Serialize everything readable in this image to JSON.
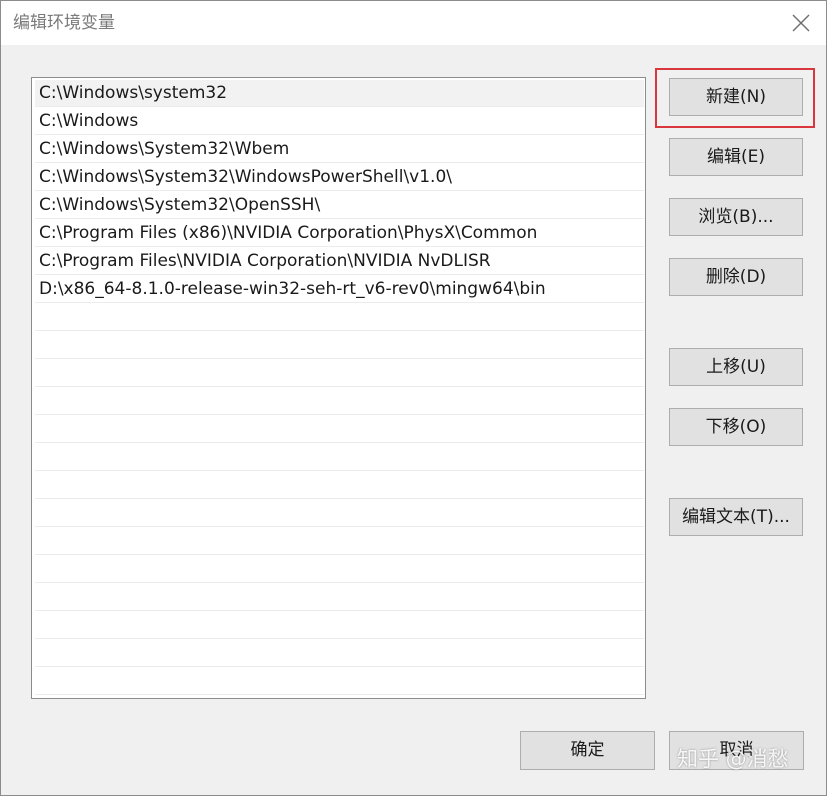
{
  "window": {
    "title": "编辑环境变量"
  },
  "path_list": {
    "items": [
      "C:\\Windows\\system32",
      "C:\\Windows",
      "C:\\Windows\\System32\\Wbem",
      "C:\\Windows\\System32\\WindowsPowerShell\\v1.0\\",
      "C:\\Windows\\System32\\OpenSSH\\",
      "C:\\Program Files (x86)\\NVIDIA Corporation\\PhysX\\Common",
      "C:\\Program Files\\NVIDIA Corporation\\NVIDIA NvDLISR",
      "D:\\x86_64-8.1.0-release-win32-seh-rt_v6-rev0\\mingw64\\bin"
    ],
    "selected_index": 0
  },
  "buttons": {
    "new": "新建(N)",
    "edit": "编辑(E)",
    "browse": "浏览(B)...",
    "delete": "删除(D)",
    "move_up": "上移(U)",
    "move_down": "下移(O)",
    "edit_text": "编辑文本(T)...",
    "ok": "确定",
    "cancel": "取消"
  },
  "watermark": {
    "text": "知乎 @消愁"
  },
  "colors": {
    "highlight": "#d9363e",
    "button_bg": "#e1e1e1",
    "dialog_bg": "#f0f0f0"
  }
}
